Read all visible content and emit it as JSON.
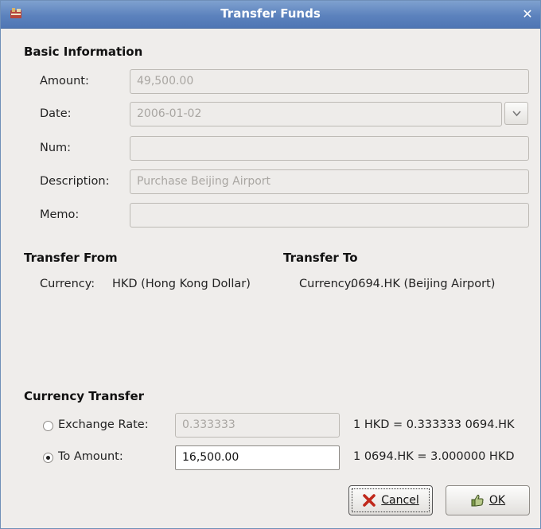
{
  "window": {
    "title": "Transfer Funds"
  },
  "basic": {
    "heading": "Basic Information",
    "amount_label": "Amount:",
    "amount_value": "49,500.00",
    "date_label": "Date:",
    "date_value": "2006-01-02",
    "num_label": "Num:",
    "num_value": "",
    "description_label": "Description:",
    "description_value": "Purchase Beijing Airport",
    "memo_label": "Memo:",
    "memo_value": ""
  },
  "transfer_from": {
    "heading": "Transfer From",
    "currency_label": "Currency:",
    "currency_value": "HKD (Hong Kong Dollar)"
  },
  "transfer_to": {
    "heading": "Transfer To",
    "currency_label": "Currency:",
    "currency_value": "0694.HK (Beijing Airport)"
  },
  "currency_transfer": {
    "heading": "Currency Transfer",
    "exchange_rate_label": "Exchange Rate:",
    "exchange_rate_value": "0.333333",
    "exchange_rate_info": "1 HKD = 0.333333 0694.HK",
    "to_amount_label": "To Amount:",
    "to_amount_value": "16,500.00",
    "to_amount_info": "1 0694.HK = 3.000000 HKD",
    "selected": "to_amount"
  },
  "buttons": {
    "cancel": "Cancel",
    "ok": "OK"
  },
  "icons": {
    "app": "app-icon",
    "close": "close-icon",
    "dropdown": "chevron-down-icon",
    "cancel": "cross-icon",
    "ok": "thumb-icon"
  },
  "colors": {
    "titlebar": "#5c82bd",
    "title_text": "#ffffff",
    "cancel_icon": "#c0281b",
    "ok_icon": "#6a8a3a"
  }
}
